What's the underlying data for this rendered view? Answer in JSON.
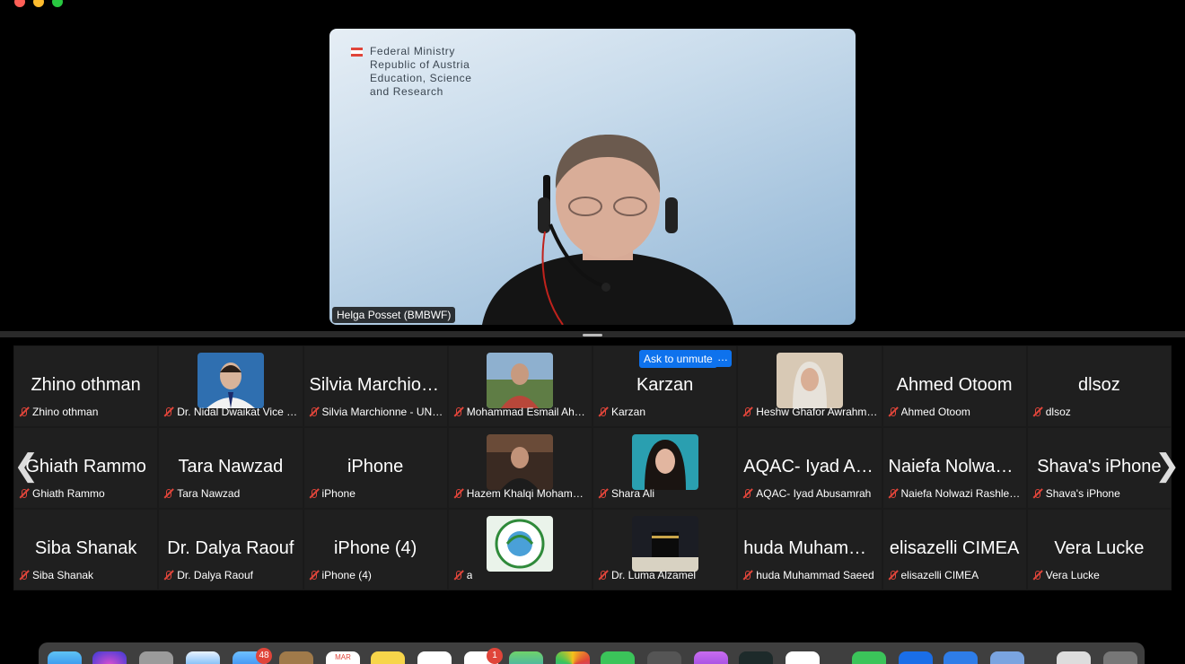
{
  "speaker": {
    "name": "Helga Posset (BMBWF)",
    "slide_lines": [
      "Federal Ministry",
      "Republic of Austria",
      "Education, Science",
      "and Research"
    ]
  },
  "controls": {
    "ask_to_unmute": "Ask to unmute",
    "more": "…",
    "prev": "❮",
    "next": "❯"
  },
  "participants": [
    {
      "big": "Zhino othman",
      "name": "Zhino othman"
    },
    {
      "big": "",
      "name": "Dr. Nidal Dwaikat Vice P...",
      "avatar": "man-blue-bg"
    },
    {
      "big": "Silvia Marchion...",
      "name": "Silvia Marchionne - UNI..."
    },
    {
      "big": "",
      "name": "Mohammad Esmail Ahm...",
      "avatar": "man-outdoors"
    },
    {
      "big": "Karzan",
      "name": "Karzan"
    },
    {
      "big": "",
      "name": "Heshw Ghafor Awrahman",
      "avatar": "woman-hijab"
    },
    {
      "big": "Ahmed Otoom",
      "name": "Ahmed Otoom"
    },
    {
      "big": "dlsoz",
      "name": "dlsoz"
    },
    {
      "big": "Ghiath Rammo",
      "name": "Ghiath Rammo"
    },
    {
      "big": "Tara Nawzad",
      "name": "Tara Nawzad"
    },
    {
      "big": "iPhone",
      "name": "iPhone"
    },
    {
      "big": "",
      "name": "Hazem Khalqi Mohamm...",
      "avatar": "man-speaking"
    },
    {
      "big": "",
      "name": "Shara Ali",
      "avatar": "woman-portrait"
    },
    {
      "big": "AQAC- Iyad Ab...",
      "name": "AQAC- Iyad Abusamrah"
    },
    {
      "big": "Naiefa Nolwazi...",
      "name": "Naiefa Nolwazi Rashled..."
    },
    {
      "big": "Shava's iPhone",
      "name": "Shava's iPhone"
    },
    {
      "big": "Siba Shanak",
      "name": "Siba Shanak"
    },
    {
      "big": "Dr. Dalya Raouf",
      "name": "Dr. Dalya Raouf"
    },
    {
      "big": "iPhone (4)",
      "name": "iPhone (4)"
    },
    {
      "big": "",
      "name": "a",
      "avatar": "emblem-logo"
    },
    {
      "big": "",
      "name": "Dr. Luma Alzamel",
      "avatar": "kaaba"
    },
    {
      "big": "huda Muhamm...",
      "name": "huda Muhammad Saeed"
    },
    {
      "big": "elisazelli CIMEA",
      "name": "elisazelli CIMEA"
    },
    {
      "big": "Vera Lucke",
      "name": "Vera Lucke"
    }
  ],
  "dock": {
    "mail_badge": "48",
    "calendar_month": "MAR",
    "reminders_badge": "1"
  },
  "colors": {
    "accent_blue": "#0e72ed",
    "muted_red": "#e0453a",
    "tile_bg": "#1f1f1f"
  }
}
